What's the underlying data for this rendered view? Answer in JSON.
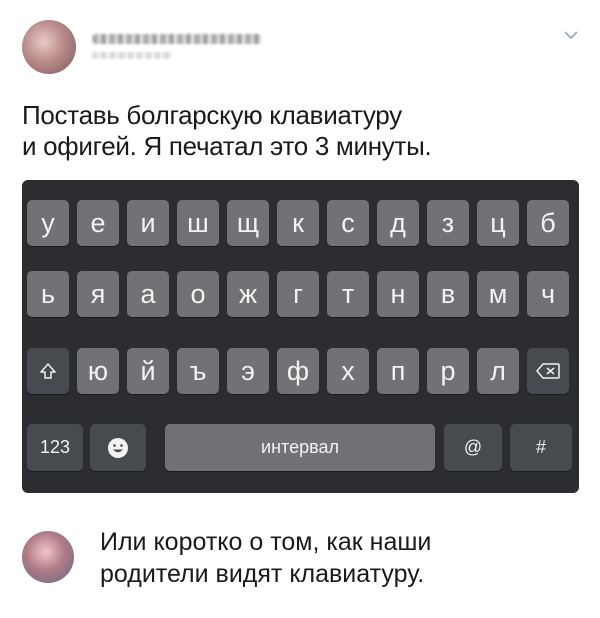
{
  "tweet": {
    "text_line1": "Поставь болгарскую клавиатуру",
    "text_line2": "и офигей. Я печатал это 3 минуты."
  },
  "keyboard": {
    "row1": [
      "у",
      "е",
      "и",
      "ш",
      "щ",
      "к",
      "с",
      "д",
      "з",
      "ц",
      "б"
    ],
    "row2": [
      "ь",
      "я",
      "а",
      "о",
      "ж",
      "г",
      "т",
      "н",
      "в",
      "м",
      "ч"
    ],
    "row3": [
      "ю",
      "й",
      "ъ",
      "э",
      "ф",
      "х",
      "п",
      "р",
      "л"
    ],
    "numbers_label": "123",
    "space_label": "интервал",
    "at_label": "@",
    "hash_label": "#",
    "shift_icon": "shift-icon",
    "backspace_icon": "backspace-icon",
    "emoji_icon": "emoji-icon"
  },
  "reply": {
    "text_line1": "Или коротко о том, как наши",
    "text_line2": "родители видят клавиатуру."
  },
  "colors": {
    "keyboard_bg": "#2b2d30",
    "key": "#707275",
    "key_dark": "#474a4e"
  }
}
